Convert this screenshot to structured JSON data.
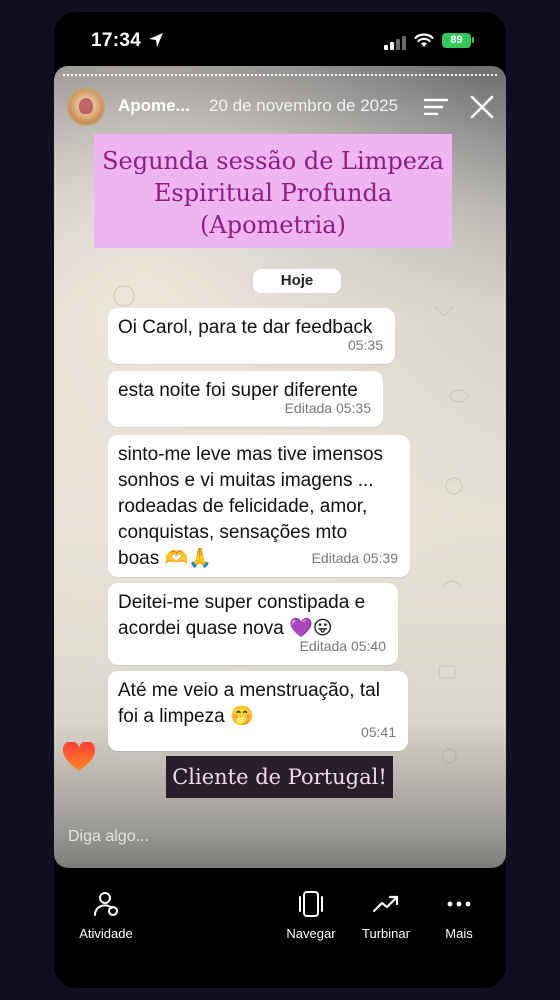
{
  "status_bar": {
    "time": "17:34",
    "battery": "89",
    "icons": [
      "location-arrow-icon",
      "signal-icon",
      "wifi-icon",
      "battery-icon"
    ]
  },
  "story": {
    "username": "Apome...",
    "date": "20 de novembro de 2025",
    "title_lines": [
      "Segunda sessão de Limpeza",
      "Espiritual Profunda",
      "(Apometria)"
    ],
    "chat": {
      "day_label": "Hoje",
      "messages": [
        {
          "text": "Oi Carol, para te dar feedback",
          "meta": "05:35"
        },
        {
          "text": "esta noite foi super diferente",
          "meta": "Editada 05:35"
        },
        {
          "text": "sinto-me leve mas tive imensos sonhos e vi muitas imagens ... rodeadas de felicidade, amor, conquistas, sensações mto boas 🫶🙏",
          "meta": "Editada 05:39"
        },
        {
          "text": "Deitei-me super constipada e acordei quase nova 💜😛",
          "meta": "Editada 05:40"
        },
        {
          "text": "Até me veio a menstruação, tal foi a limpeza 🤭",
          "meta": "05:41"
        }
      ]
    },
    "caption": "Cliente de Portugal!",
    "reply_placeholder": "Diga algo..."
  },
  "bottom_bar": {
    "activity": "Atividade",
    "browse": "Navegar",
    "boost": "Turbinar",
    "more": "Mais"
  },
  "colors": {
    "title_bg": "#efb5f2",
    "title_text": "#8d1f83",
    "battery": "#34c759",
    "caption_bg": "#2a1e2a"
  }
}
